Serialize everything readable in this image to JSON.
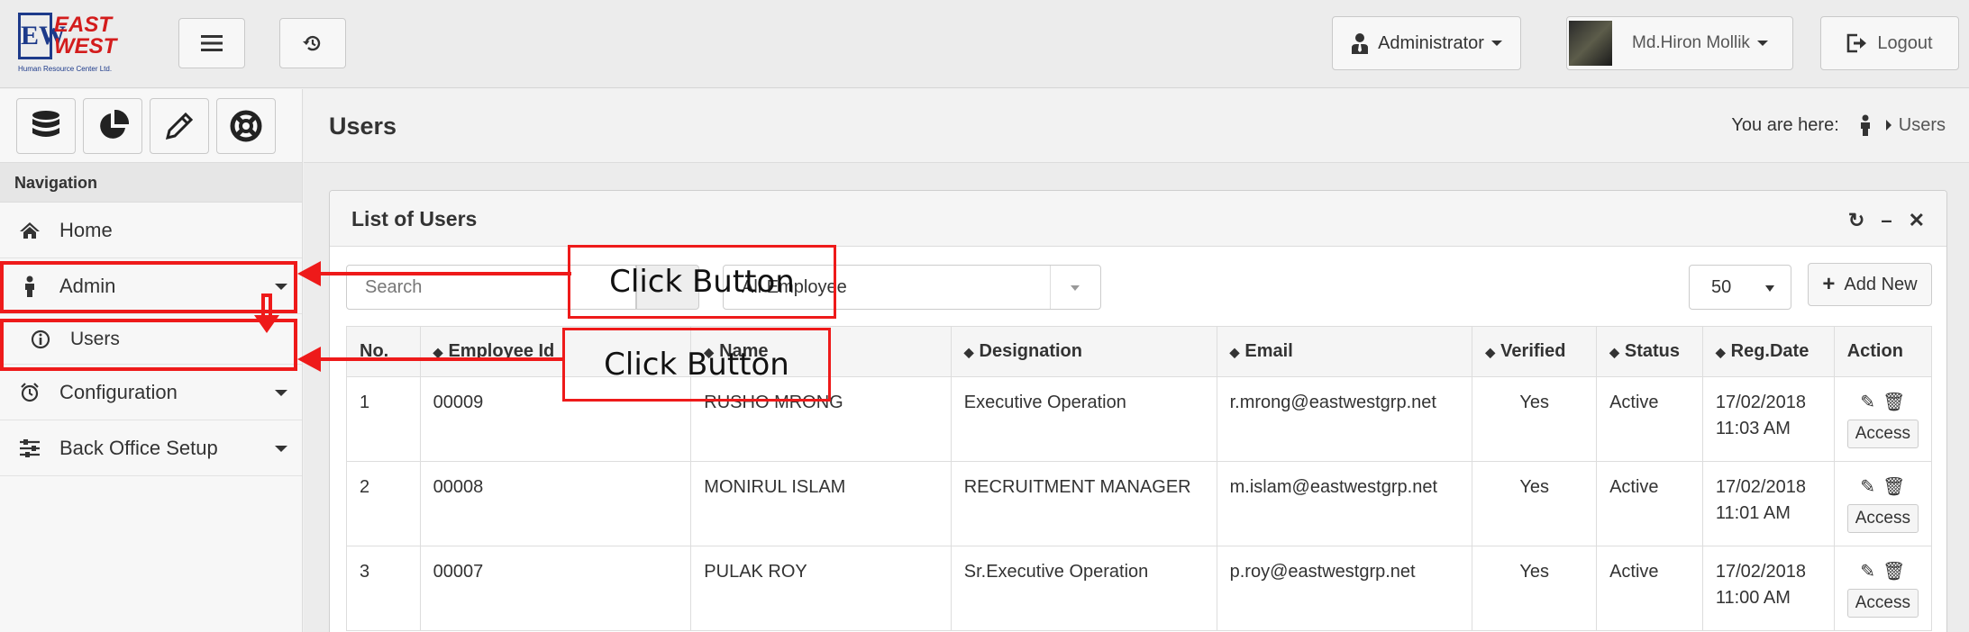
{
  "header": {
    "logo": {
      "mark": "EW",
      "line1": "EAST",
      "line2": "WEST",
      "subtitle": "Human Resource Center Ltd."
    },
    "role_label": "Administrator",
    "user_label": "Md.Hiron Mollik",
    "logout_label": "Logout"
  },
  "sidebar": {
    "heading": "Navigation",
    "items": [
      {
        "label": "Home"
      },
      {
        "label": "Admin"
      },
      {
        "label": "Users"
      },
      {
        "label": "Configuration"
      },
      {
        "label": "Back Office Setup"
      }
    ]
  },
  "page": {
    "title": "Users",
    "breadcrumb_prefix": "You are here:",
    "breadcrumb_current": "Users"
  },
  "panel": {
    "title": "List of Users",
    "search_placeholder": "Search",
    "filter_value": "All Employee",
    "page_size": "50",
    "add_new_label": "Add New",
    "columns": [
      "No.",
      "Employee Id",
      "Name",
      "Designation",
      "Email",
      "Verified",
      "Status",
      "Reg.Date",
      "Action"
    ],
    "rows": [
      {
        "no": "1",
        "emp_id": "00009",
        "name": "RUSHO MRONG",
        "designation": "Executive Operation",
        "email": "r.mrong@eastwestgrp.net",
        "verified": "Yes",
        "status": "Active",
        "date": "17/02/2018",
        "time": "11:03 AM",
        "access": "Access"
      },
      {
        "no": "2",
        "emp_id": "00008",
        "name": "MONIRUL ISLAM",
        "designation": "RECRUITMENT MANAGER",
        "email": "m.islam@eastwestgrp.net",
        "verified": "Yes",
        "status": "Active",
        "date": "17/02/2018",
        "time": "11:01 AM",
        "access": "Access"
      },
      {
        "no": "3",
        "emp_id": "00007",
        "name": "PULAK ROY",
        "designation": "Sr.Executive Operation",
        "email": "p.roy@eastwestgrp.net",
        "verified": "Yes",
        "status": "Active",
        "date": "17/02/2018",
        "time": "11:00 AM",
        "access": "Access"
      }
    ]
  },
  "annotations": {
    "label_1": "Click Button",
    "label_2": "Click Button"
  },
  "colors": {
    "annotation": "#ee1a1a",
    "logo_blue": "#1d3a8a",
    "logo_red": "#d31c1c"
  }
}
